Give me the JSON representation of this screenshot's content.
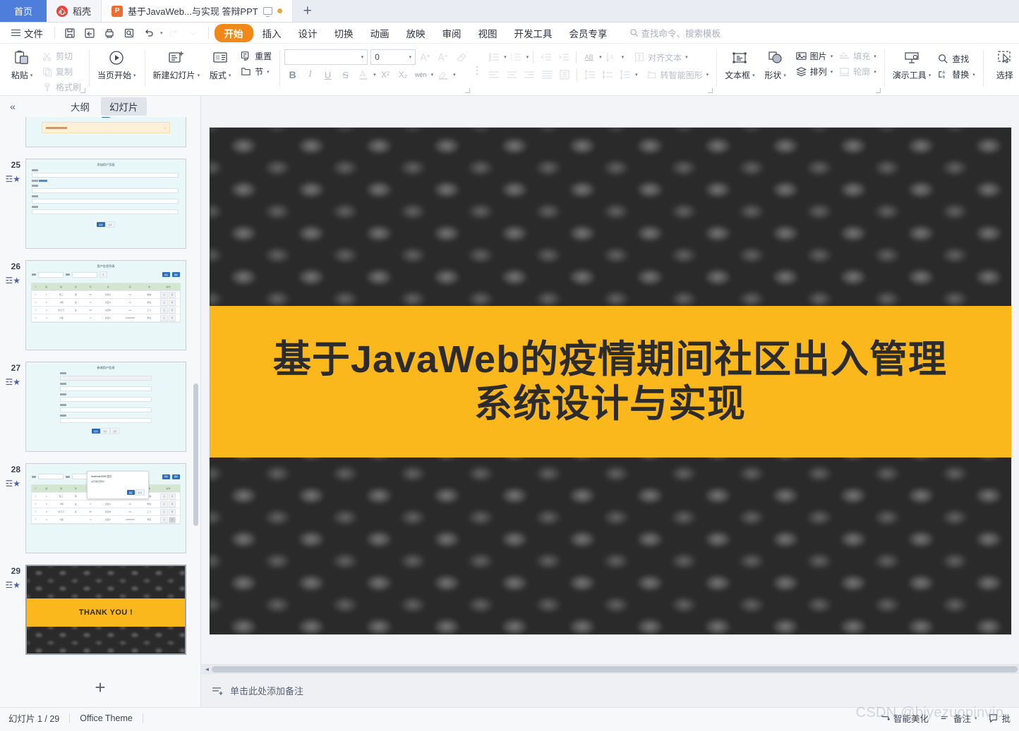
{
  "window": {
    "tabs": [
      {
        "label": "首页",
        "kind": "home"
      },
      {
        "label": "稻壳",
        "kind": "inactive",
        "icon": "docer-icon"
      },
      {
        "label": "基于JavaWeb...与实现 答辩PPT",
        "kind": "active",
        "icon": "ppt-icon",
        "modified": true
      }
    ],
    "new_tab_label": "+"
  },
  "menubar": {
    "file_label": "文件",
    "quick_access": [
      "save-icon",
      "save-as-icon",
      "print-icon",
      "print-preview-icon",
      "undo-icon",
      "redo-icon",
      "customize-icon"
    ],
    "items": [
      "开始",
      "插入",
      "设计",
      "切换",
      "动画",
      "放映",
      "审阅",
      "视图",
      "开发工具",
      "会员专享"
    ],
    "selected": "开始",
    "search_placeholder": "查找命令、搜索模板"
  },
  "ribbon": {
    "clipboard": {
      "paste": "粘贴",
      "cut": "剪切",
      "copy": "复制",
      "format_painter": "格式刷"
    },
    "present": {
      "from_current": "当页开始"
    },
    "slides": {
      "new_slide": "新建幻灯片",
      "layout": "版式",
      "reset": "重置",
      "section": "节"
    },
    "font": {
      "family_value": "",
      "size_value": "0",
      "grow": "A+",
      "shrink": "A-",
      "clear_format": "clear-format-icon",
      "bold": "B",
      "italic": "I",
      "underline": "U",
      "strike": "S",
      "font_color": "A",
      "superscript": "X²",
      "subscript": "X₂",
      "pinyin": "wén",
      "highlight": "highlight-icon"
    },
    "paragraph": {
      "bullets": "bullets-icon",
      "numbering": "numbering-icon",
      "decrease_indent": "decrease-indent-icon",
      "increase_indent": "increase-indent-icon",
      "text_direction": "AB",
      "char_spacing": "char-spacing-icon",
      "align_text": "对齐文本",
      "align_left": "align-left-icon",
      "align_center": "align-center-icon",
      "align_right": "align-right-icon",
      "justify": "justify-icon",
      "distribute": "distribute-icon",
      "line_spacing_a": "line-spacing-icon",
      "space_before": "space-before-icon",
      "line_spacing": "line-spacing-menu-icon",
      "to_smartart": "转智能图形"
    },
    "drawing": {
      "textbox": "文本框",
      "shapes": "形状",
      "picture": "图片",
      "arrange": "排列",
      "fill": "填充",
      "outline": "轮廓"
    },
    "tools": {
      "present_tools": "演示工具",
      "find": "查找",
      "replace": "替换",
      "select": "选择"
    }
  },
  "leftpanel": {
    "collapse_icon": "«",
    "tabs": [
      {
        "label": "大纲",
        "active": false
      },
      {
        "label": "幻灯片",
        "active": true
      }
    ],
    "thumbnails": [
      {
        "number": "",
        "type": "form-partial",
        "title": ""
      },
      {
        "number": "25",
        "type": "form",
        "title": "添加用户页面"
      },
      {
        "number": "26",
        "type": "table",
        "title": "用户信息列表"
      },
      {
        "number": "27",
        "type": "form",
        "title": "修改用户信息"
      },
      {
        "number": "28",
        "type": "table-dialog",
        "title": ""
      },
      {
        "number": "29",
        "type": "thankyou",
        "title": "THANK YOU !"
      }
    ],
    "add_slide_label": "+"
  },
  "slide": {
    "title_line1": "基于JavaWeb的疫情期间社区出入管理",
    "title_line2": "系统设计与实现",
    "band_color": "#FAB81D",
    "background_color": "#2b2b2b"
  },
  "notes": {
    "placeholder": "单击此处添加备注",
    "icon": "add-notes-icon"
  },
  "statusbar": {
    "slide_counter": "幻灯片 1 / 29",
    "theme": "Office Theme",
    "beautify": "智能美化",
    "notes": "备注",
    "comments": "批",
    "watermark": "CSDN @biyezuopinvip"
  },
  "thumb_content": {
    "form_fields": [
      "姓名",
      "性别",
      "年龄",
      "身份证",
      "电话"
    ],
    "table_headers": [
      "",
      "编号",
      "姓名",
      "性别",
      "年龄",
      "住址",
      "身份证",
      "电话",
      "操作"
    ],
    "table_rows": [
      [
        "1",
        "张三",
        "男",
        "25",
        "社区A",
        "11",
        "警察"
      ],
      [
        "2",
        "小明",
        "女",
        "9",
        "社区A",
        "11",
        "学生"
      ],
      [
        "3",
        "刘刀刀",
        "女",
        "25",
        "社区B",
        "13",
        "工人"
      ],
      [
        "4",
        "小强",
        "",
        "3",
        "社区C",
        "19996363",
        "学生"
      ]
    ],
    "dialog_title": "localhost:8080 显示",
    "dialog_text": "是否确定删除?",
    "buttons": [
      "添加用户",
      "删除"
    ],
    "row_buttons": [
      "修改",
      "删除"
    ]
  }
}
